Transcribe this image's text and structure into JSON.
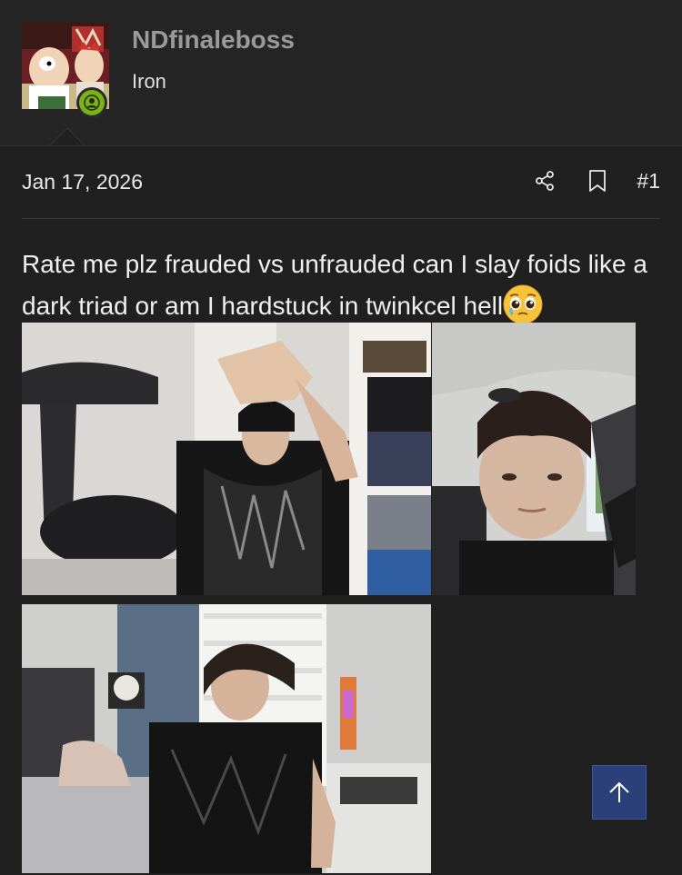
{
  "user": {
    "name": "NDfinaleboss",
    "rank": "Iron",
    "online": true
  },
  "post": {
    "date": "Jan 17, 2026",
    "number": "#1",
    "text": "Rate me plz frauded vs unfrauded can I slay foids like a dark triad or am I hardstuck in twinkcel hell",
    "emoji": "pleading-face-emoji"
  },
  "actions": {
    "share_icon": "share-icon",
    "bookmark_icon": "bookmark-icon",
    "back_to_top_icon": "arrow-up-icon"
  },
  "attachments": [
    {
      "name": "photo-mirror-selfie-room"
    },
    {
      "name": "photo-car-selfie"
    },
    {
      "name": "photo-bedroom-window"
    }
  ],
  "colors": {
    "background": "#202020",
    "header_bg": "#252525",
    "online_badge": "#7ab317",
    "back_to_top": "#2b3f79",
    "username": "#9a9a9a"
  }
}
